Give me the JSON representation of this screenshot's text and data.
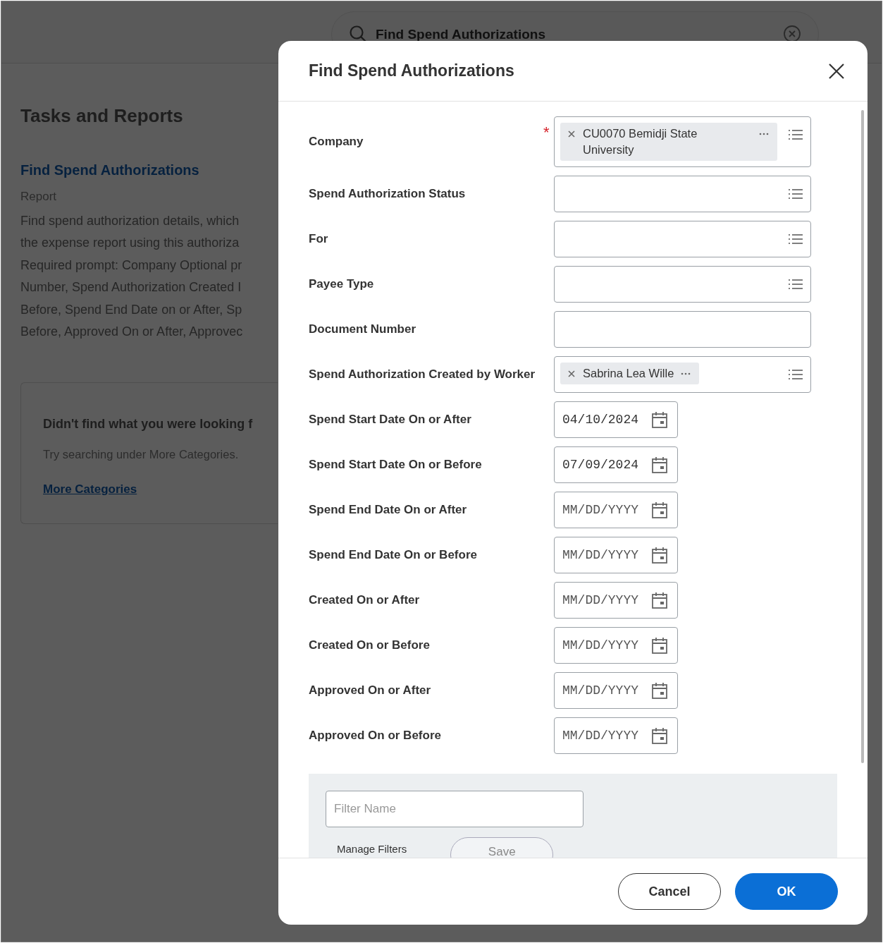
{
  "search": {
    "value": "Find Spend Authorizations"
  },
  "sidebar": {
    "heading": "Tasks and Reports",
    "result": {
      "title": "Find Spend Authorizations",
      "type": "Report",
      "description_lines": [
        "Find spend authorization details, which",
        "the expense report using this authoriza",
        "Required prompt: Company Optional pr",
        "Number, Spend Authorization Created I",
        "Before, Spend End Date on or After, Sp",
        "Before, Approved On or After, Approvec"
      ]
    },
    "help_card": {
      "title": "Didn't find what you were looking f",
      "text": "Try searching under More Categories.",
      "link": "More Categories"
    }
  },
  "dialog": {
    "title": "Find Spend Authorizations",
    "required_symbol": "*",
    "fields": [
      {
        "label": "Company",
        "kind": "prompt",
        "required": true,
        "chips": [
          "CU0070 Bemidji State University"
        ]
      },
      {
        "label": "Spend Authorization Status",
        "kind": "prompt",
        "required": false
      },
      {
        "label": "For",
        "kind": "prompt",
        "required": false
      },
      {
        "label": "Payee Type",
        "kind": "prompt",
        "required": false
      },
      {
        "label": "Document Number",
        "kind": "text",
        "required": false
      },
      {
        "label": "Spend Authorization Created by Worker",
        "kind": "prompt",
        "required": false,
        "chips": [
          "Sabrina Lea Wille"
        ]
      },
      {
        "label": "Spend Start Date On or After",
        "kind": "date",
        "required": false,
        "value": "04/10/2024"
      },
      {
        "label": "Spend Start Date On or Before",
        "kind": "date",
        "required": false,
        "value": "07/09/2024"
      },
      {
        "label": "Spend End Date On or After",
        "kind": "date",
        "required": false,
        "placeholder": "MM/DD/YYYY"
      },
      {
        "label": "Spend End Date On or Before",
        "kind": "date",
        "required": false,
        "placeholder": "MM/DD/YYYY"
      },
      {
        "label": "Created On or After",
        "kind": "date",
        "required": false,
        "placeholder": "MM/DD/YYYY"
      },
      {
        "label": "Created On or Before",
        "kind": "date",
        "required": false,
        "placeholder": "MM/DD/YYYY"
      },
      {
        "label": "Approved On or After",
        "kind": "date",
        "required": false,
        "placeholder": "MM/DD/YYYY"
      },
      {
        "label": "Approved On or Before",
        "kind": "date",
        "required": false,
        "placeholder": "MM/DD/YYYY"
      }
    ],
    "filter": {
      "placeholder": "Filter Name",
      "manage_label": "Manage Filters",
      "save_label": "Save"
    },
    "buttons": [
      {
        "label": "Cancel",
        "kind": "secondary"
      },
      {
        "label": "OK",
        "kind": "primary"
      }
    ]
  }
}
